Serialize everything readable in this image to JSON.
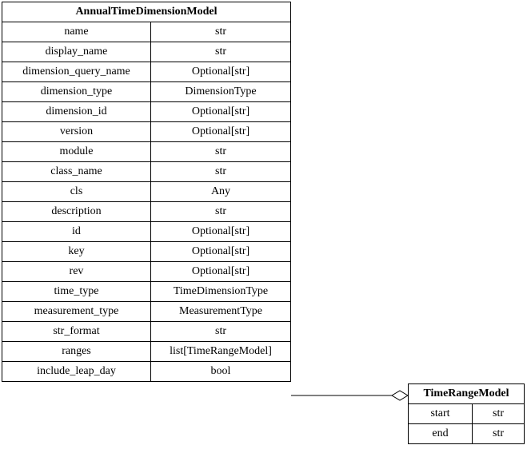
{
  "leftClass": {
    "title": "AnnualTimeDimensionModel",
    "attrs": [
      {
        "name": "name",
        "type": "str"
      },
      {
        "name": "display_name",
        "type": "str"
      },
      {
        "name": "dimension_query_name",
        "type": "Optional[str]"
      },
      {
        "name": "dimension_type",
        "type": "DimensionType"
      },
      {
        "name": "dimension_id",
        "type": "Optional[str]"
      },
      {
        "name": "version",
        "type": "Optional[str]"
      },
      {
        "name": "module",
        "type": "str"
      },
      {
        "name": "class_name",
        "type": "str"
      },
      {
        "name": "cls",
        "type": "Any"
      },
      {
        "name": "description",
        "type": "str"
      },
      {
        "name": "id",
        "type": "Optional[str]"
      },
      {
        "name": "key",
        "type": "Optional[str]"
      },
      {
        "name": "rev",
        "type": "Optional[str]"
      },
      {
        "name": "time_type",
        "type": "TimeDimensionType"
      },
      {
        "name": "measurement_type",
        "type": "MeasurementType"
      },
      {
        "name": "str_format",
        "type": "str"
      },
      {
        "name": "ranges",
        "type": "list[TimeRangeModel]"
      },
      {
        "name": "include_leap_day",
        "type": "bool"
      }
    ]
  },
  "rightClass": {
    "title": "TimeRangeModel",
    "attrs": [
      {
        "name": "start",
        "type": "str"
      },
      {
        "name": "end",
        "type": "str"
      }
    ]
  }
}
